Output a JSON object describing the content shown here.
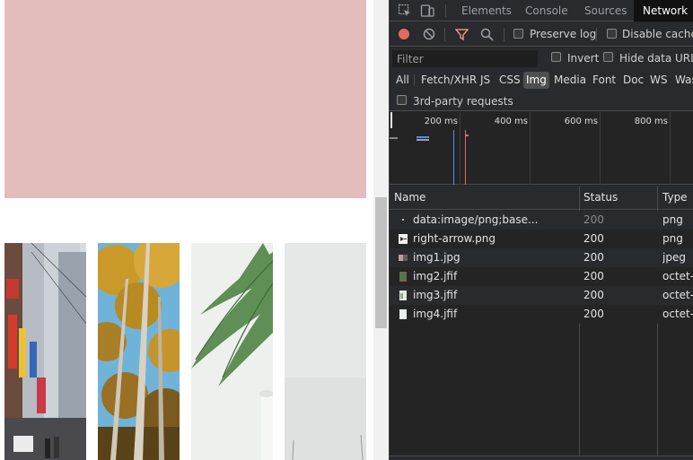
{
  "devtools": {
    "tabs": [
      "Elements",
      "Console",
      "Sources",
      "Network"
    ],
    "active_tab": "Network",
    "toolbar": {
      "preserve_log_label": "Preserve log",
      "disable_cache_label": "Disable cache"
    },
    "filter": {
      "placeholder": "Filter",
      "invert_label": "Invert",
      "hide_data_urls_label": "Hide data URLs"
    },
    "type_filters": [
      "All",
      "Fetch/XHR",
      "JS",
      "CSS",
      "Img",
      "Media",
      "Font",
      "Doc",
      "WS",
      "Wasm"
    ],
    "active_type": "Img",
    "third_party_label": "3rd-party requests",
    "overview": {
      "ticks": [
        "200 ms",
        "400 ms",
        "600 ms",
        "800 ms"
      ]
    },
    "table": {
      "columns": [
        "Name",
        "Status",
        "Type"
      ],
      "rows": [
        {
          "name": "data:image/png;base...",
          "status": "200",
          "type": "png",
          "status_dim": true,
          "icon": "tiny-image-icon"
        },
        {
          "name": "right-arrow.png",
          "status": "200",
          "type": "png",
          "icon": "arrow-image-icon"
        },
        {
          "name": "img1.jpg",
          "status": "200",
          "type": "jpeg",
          "icon": "photo-thumbnail-icon"
        },
        {
          "name": "img2.jfif",
          "status": "200",
          "type": "octet-s",
          "icon": "photo-thumbnail-icon"
        },
        {
          "name": "img3.jfif",
          "status": "200",
          "type": "octet-s",
          "icon": "photo-thumbnail-icon"
        },
        {
          "name": "img4.jfif",
          "status": "200",
          "type": "octet-s",
          "icon": "photo-thumbnail-icon"
        }
      ]
    }
  },
  "colors": {
    "hero": "#e3bcbc",
    "devtools_bg": "#242424",
    "record_red": "#e46962",
    "filter_red": "#f28b82",
    "accent_blue": "#4d90fe"
  }
}
